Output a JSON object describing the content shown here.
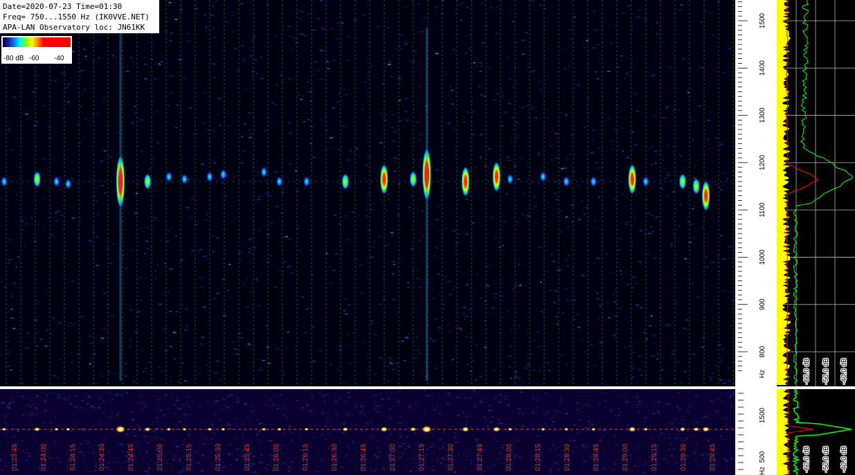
{
  "info": {
    "line1": "Date=2020-07-23 Time=01:30",
    "line2": "Freq= 750...1550 Hz (IK0VVE.NET)",
    "line3": "APA-LAN Observatory loc: JN61KK"
  },
  "legend": {
    "labels": [
      "-80 dB",
      "-60",
      "-40"
    ]
  },
  "colors": {
    "background": "#000000",
    "grid": "#2a8a2a",
    "time_label": "#ff2020",
    "axis_text": "#000000",
    "spectrum_floor": "#ffff00",
    "spectrum_avg": "#00ff00",
    "spectrum_peak": "#ff0000"
  },
  "chart_data": [
    {
      "type": "heatmap",
      "title": "Date=2020-07-23 Time=01:30",
      "y_unit": "Hz",
      "ylim": [
        750,
        1550
      ],
      "yticks": [
        800,
        900,
        1000,
        1100,
        1200,
        1300,
        1400,
        1500
      ],
      "ytick_labels": [
        "800",
        "900",
        "1000",
        "1100",
        "1200",
        "1300",
        "1400",
        "1500"
      ],
      "xlabels": [
        "01:23:45",
        "01:24:00",
        "01:24:15",
        "01:24:30",
        "01:24:45",
        "01:25:00",
        "01:25:15",
        "01:25:30",
        "01:25:45",
        "01:26:00",
        "01:26:15",
        "01:26:30",
        "01:26:45",
        "01:27:00",
        "01:27:15",
        "01:27:30",
        "01:27:45",
        "01:28:00",
        "01:28:15",
        "01:28:30",
        "01:28:45",
        "01:29:00",
        "01:29:15",
        "01:29:30",
        "01:29:45"
      ],
      "carrier_hz": 1160,
      "echoes": [
        {
          "t": "01:23:30",
          "f": 1165,
          "strength": "strong"
        },
        {
          "t": "01:23:40",
          "f": 1160,
          "strength": "weak"
        },
        {
          "t": "01:23:57",
          "f": 1165,
          "strength": "medium"
        },
        {
          "t": "01:24:07",
          "f": 1160,
          "strength": "weak"
        },
        {
          "t": "01:24:13",
          "f": 1155,
          "strength": "weak"
        },
        {
          "t": "01:24:40",
          "f": 1160,
          "strength": "very-strong"
        },
        {
          "t": "01:24:54",
          "f": 1160,
          "strength": "medium"
        },
        {
          "t": "01:25:05",
          "f": 1170,
          "strength": "weak"
        },
        {
          "t": "01:25:13",
          "f": 1165,
          "strength": "weak"
        },
        {
          "t": "01:25:26",
          "f": 1170,
          "strength": "weak"
        },
        {
          "t": "01:25:33",
          "f": 1175,
          "strength": "weak"
        },
        {
          "t": "01:25:54",
          "f": 1180,
          "strength": "weak"
        },
        {
          "t": "01:26:02",
          "f": 1160,
          "strength": "weak"
        },
        {
          "t": "01:26:16",
          "f": 1160,
          "strength": "weak"
        },
        {
          "t": "01:26:36",
          "f": 1160,
          "strength": "medium"
        },
        {
          "t": "01:26:56",
          "f": 1165,
          "strength": "strong"
        },
        {
          "t": "01:27:11",
          "f": 1165,
          "strength": "medium"
        },
        {
          "t": "01:27:18",
          "f": 1175,
          "strength": "very-strong"
        },
        {
          "t": "01:27:38",
          "f": 1160,
          "strength": "strong"
        },
        {
          "t": "01:27:54",
          "f": 1170,
          "strength": "strong"
        },
        {
          "t": "01:28:01",
          "f": 1165,
          "strength": "weak"
        },
        {
          "t": "01:28:18",
          "f": 1170,
          "strength": "weak"
        },
        {
          "t": "01:28:30",
          "f": 1160,
          "strength": "weak"
        },
        {
          "t": "01:28:44",
          "f": 1160,
          "strength": "weak"
        },
        {
          "t": "01:29:04",
          "f": 1165,
          "strength": "strong"
        },
        {
          "t": "01:29:11",
          "f": 1160,
          "strength": "weak"
        },
        {
          "t": "01:29:30",
          "f": 1160,
          "strength": "medium"
        },
        {
          "t": "01:29:37",
          "f": 1150,
          "strength": "medium"
        },
        {
          "t": "01:29:42",
          "f": 1130,
          "strength": "strong"
        }
      ]
    },
    {
      "type": "line",
      "xlabel": "dB",
      "xtick_labels": [
        "-60.0 dB",
        "-50.0 dB",
        "-40.0 dB"
      ],
      "series": [
        {
          "values": "noise floor (yellow)"
        },
        {
          "values": "average (green)"
        },
        {
          "values": "peak (red)"
        }
      ]
    },
    {
      "type": "heatmap",
      "y_unit": "Hz",
      "ytick_labels": [
        "1500",
        "500"
      ],
      "xtick_labels": [
        "-60.0 dB",
        "-50.0 dB",
        "-40.0 dB"
      ]
    }
  ]
}
